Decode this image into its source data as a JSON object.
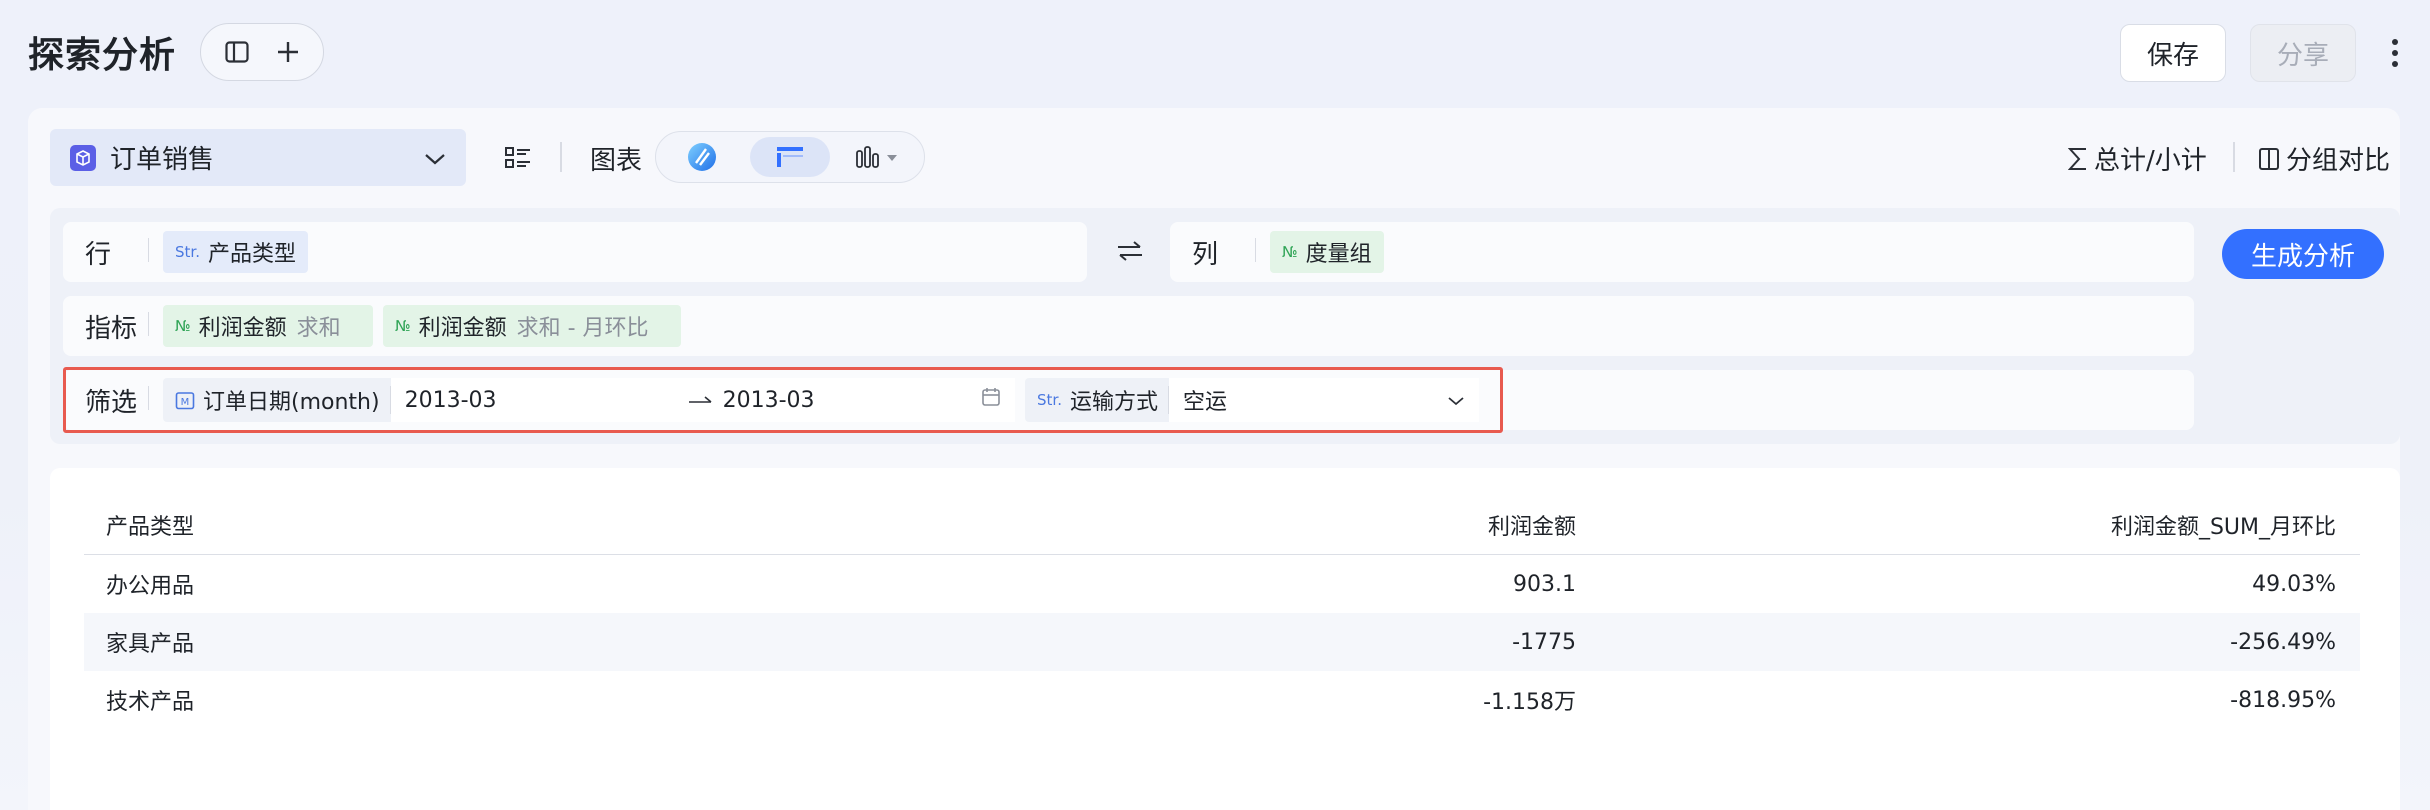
{
  "header": {
    "title": "探索分析",
    "save_label": "保存",
    "share_label": "分享"
  },
  "toolbar": {
    "dataset": "订单销售",
    "chart_label": "图表",
    "total_label": "总计/小计",
    "group_compare_label": "分组对比"
  },
  "config": {
    "row_label": "行",
    "row_field": {
      "type": "Str.",
      "name": "产品类型"
    },
    "col_label": "列",
    "col_field": {
      "type": "№",
      "name": "度量组"
    },
    "metric_label": "指标",
    "metrics": [
      {
        "type": "№",
        "name": "利润金额",
        "agg": "求和"
      },
      {
        "type": "№",
        "name": "利润金额",
        "agg": "求和 - 月环比"
      }
    ],
    "filter_label": "筛选",
    "date_filter": {
      "type": "M",
      "name": "订单日期(month)",
      "start": "2013-03",
      "end": "2013-03"
    },
    "ship_filter": {
      "type": "Str.",
      "name": "运输方式",
      "value": "空运"
    },
    "generate_label": "生成分析"
  },
  "table": {
    "headers": [
      "产品类型",
      "利润金额",
      "利润金额_SUM_月环比"
    ],
    "rows": [
      [
        "办公用品",
        "903.1",
        "49.03%"
      ],
      [
        "家具产品",
        "-1775",
        "-256.49%"
      ],
      [
        "技术产品",
        "-1.158万",
        "-818.95%"
      ]
    ]
  },
  "colors": {
    "accent": "#3370ff",
    "highlight_border": "#e85a4f",
    "dataset_icon": "#5b5fe6"
  }
}
